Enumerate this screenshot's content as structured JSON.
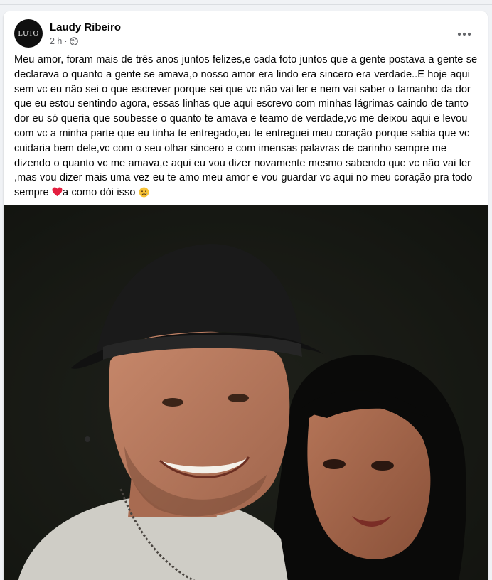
{
  "post": {
    "author": "Laudy Ribeiro",
    "avatar_text": "LUTO",
    "time": "2 h",
    "privacy_icon": "globe-icon",
    "more_icon": "more-options-icon",
    "text_main": "Meu amor, foram mais de três anos juntos felizes,e cada foto juntos que a gente postava a gente se declarava o quanto a gente se amava,o nosso amor era lindo era sincero era verdade..E hoje aqui sem vc eu não sei o que escrever porque sei que vc não vai ler e nem vai saber o tamanho da dor que eu estou sentindo agora, essas linhas que aqui escrevo com minhas lágrimas caindo de tanto dor eu só queria que soubesse o quanto te amava e teamo de verdade,vc me deixou aqui e levou com vc a minha parte que eu tinha te entregado,eu te entreguei meu coração porque sabia que vc cuidaria bem dele,vc com o seu olhar sincero e com imensas palavras de carinho sempre me dizendo o quanto vc me amava,e aqui eu vou dizer novamente mesmo sabendo que vc não vai ler ,mas vou dizer mais uma vez eu te amo meu amor e vou guardar vc aqui no meu coração pra todo sempre ",
    "text_after_heart": "a como dói isso ",
    "heart_icon": "red-heart-emoji-icon",
    "sad_icon": "crying-face-emoji-icon"
  },
  "colors": {
    "background": "#f0f2f5",
    "card": "#ffffff",
    "text": "#050505",
    "secondary_text": "#65676b"
  }
}
